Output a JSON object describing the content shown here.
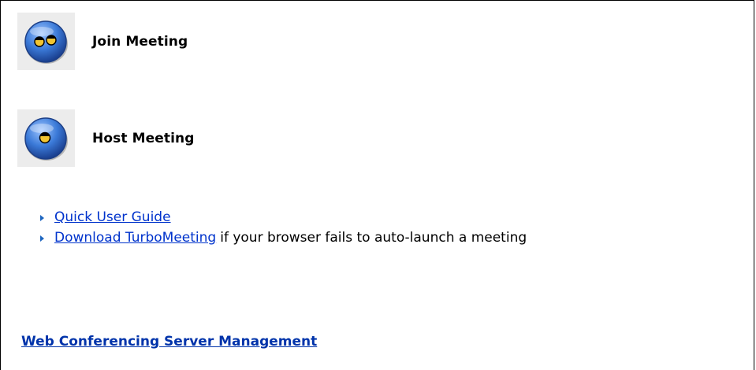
{
  "actions": {
    "join": {
      "label": "Join Meeting",
      "icon": "two-people-icon"
    },
    "host": {
      "label": "Host Meeting",
      "icon": "single-person-icon"
    }
  },
  "links": {
    "quick_guide": "Quick User Guide",
    "download": "Download TurboMeeting",
    "download_suffix": "if your browser fails to auto-launch a meeting"
  },
  "management_link": "Web Conferencing Server Management",
  "colors": {
    "link": "#0033cc",
    "icon_blue": "#2f6fd0",
    "icon_face": "#f2c531",
    "arrow": "#1e66c0"
  }
}
